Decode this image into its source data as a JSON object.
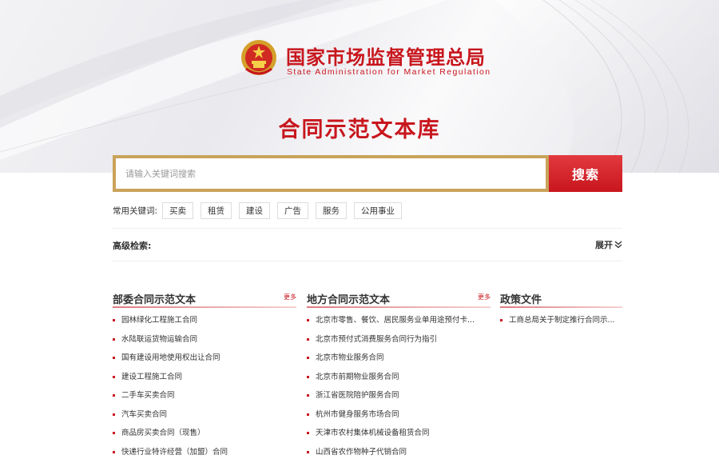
{
  "header": {
    "org_name_cn": "国家市场监督管理总局",
    "org_name_en": "State Administration for Market Regulation",
    "page_title": "合同示范文本库"
  },
  "search": {
    "placeholder": "请输入关键词搜索",
    "button_label": "搜索"
  },
  "keywords": {
    "label": "常用关键词:",
    "items": [
      "买卖",
      "租赁",
      "建设",
      "广告",
      "服务",
      "公用事业"
    ]
  },
  "advanced": {
    "label": "高级检索:",
    "toggle_label": "展开"
  },
  "columns": [
    {
      "title": "部委合同示范文本",
      "more": "更多",
      "items": [
        "园林绿化工程施工合同",
        "水陆联运货物运输合同",
        "国有建设用地使用权出让合同",
        "建设工程施工合同",
        "二手车买卖合同",
        "汽车买卖合同",
        "商品房买卖合同（现售）",
        "快递行业特许经营（加盟）合同"
      ]
    },
    {
      "title": "地方合同示范文本",
      "more": "更多",
      "items": [
        "北京市零售、餐饮、居民服务业单用途预付卡...",
        "北京市预付式消费服务合同行为指引",
        "北京市物业服务合同",
        "北京市前期物业服务合同",
        "浙江省医院陪护服务合同",
        "杭州市健身服务市场合同",
        "天津市农村集体机械设备租赁合同",
        "山西省农作物种子代销合同"
      ]
    },
    {
      "title": "政策文件",
      "items": [
        "工商总局关于制定推行合同示..."
      ]
    }
  ],
  "colors": {
    "brand_red": "#c8161d",
    "gold_border": "#c9a35a"
  }
}
